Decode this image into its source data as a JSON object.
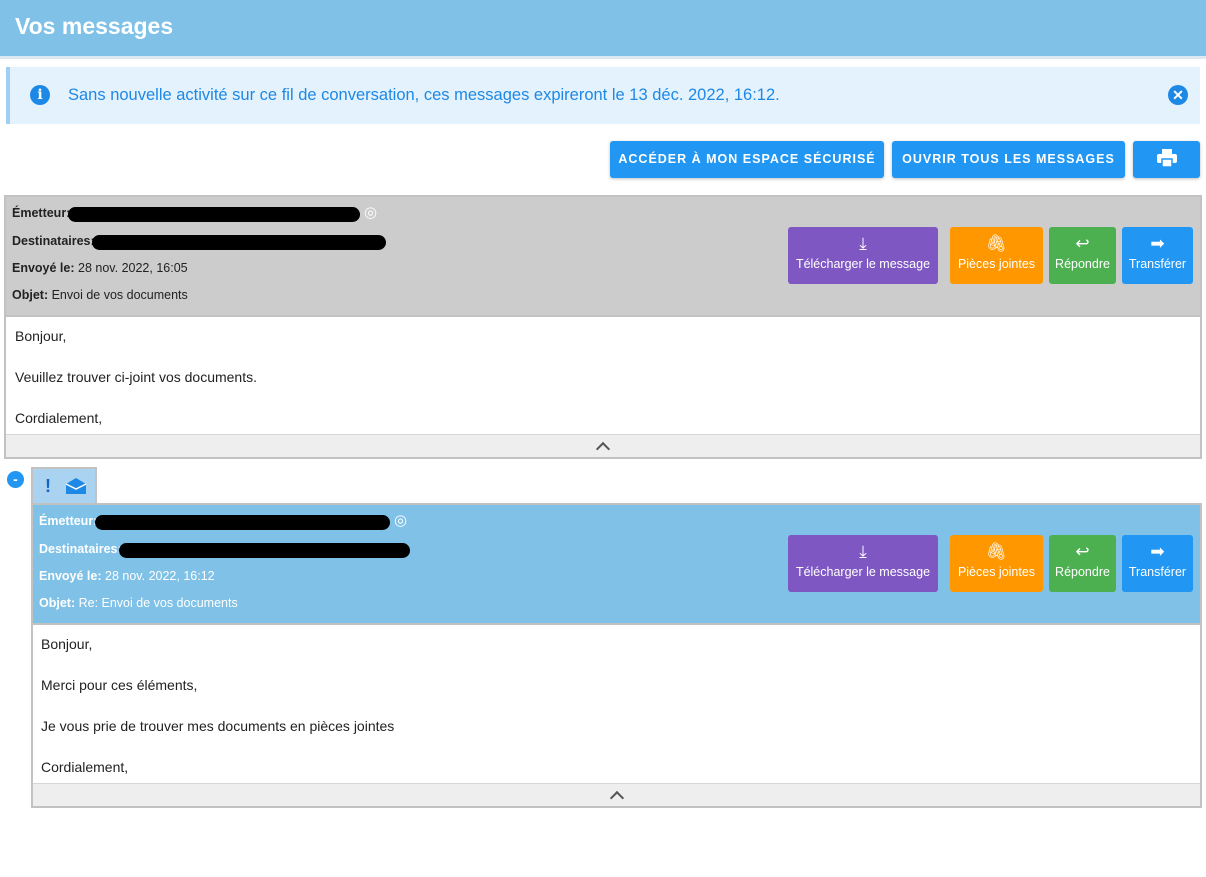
{
  "header": {
    "title": "Vos messages"
  },
  "alert": {
    "text": "Sans nouvelle activité sur ce fil de conversation, ces messages expireront le 13 déc. 2022, 16:12."
  },
  "toolbar": {
    "secure_space_label": "ACCÉDER À MON ESPACE SÉCURISÉ",
    "open_all_label": "OUVRIR TOUS LES MESSAGES",
    "print_icon": "printer-icon"
  },
  "labels": {
    "sender": "Émetteur:",
    "recipients": "Destinataires:",
    "sent_on": "Envoyé le:",
    "subject": "Objet:"
  },
  "actions": {
    "download": "Télécharger le message",
    "attachments": "Pièces jointes",
    "reply": "Répondre",
    "forward": "Transférer"
  },
  "colors": {
    "header": "#7fc1e7",
    "primary": "#2196f3",
    "download": "#7e57c2",
    "attachments": "#ff9800",
    "reply": "#4caf50",
    "forward": "#2196f3"
  },
  "messages": [
    {
      "sent_on": "28 nov. 2022, 16:05",
      "subject": "Envoi de vos documents",
      "body": [
        "Bonjour,",
        "Veuillez trouver ci-joint vos documents.",
        "Cordialement,"
      ]
    },
    {
      "sent_on": "28 nov. 2022, 16:12",
      "subject": "Re: Envoi de vos documents",
      "body": [
        "Bonjour,",
        "Merci pour ces éléments,",
        "Je vous prie de trouver mes documents en pièces jointes",
        "Cordialement,"
      ]
    }
  ]
}
